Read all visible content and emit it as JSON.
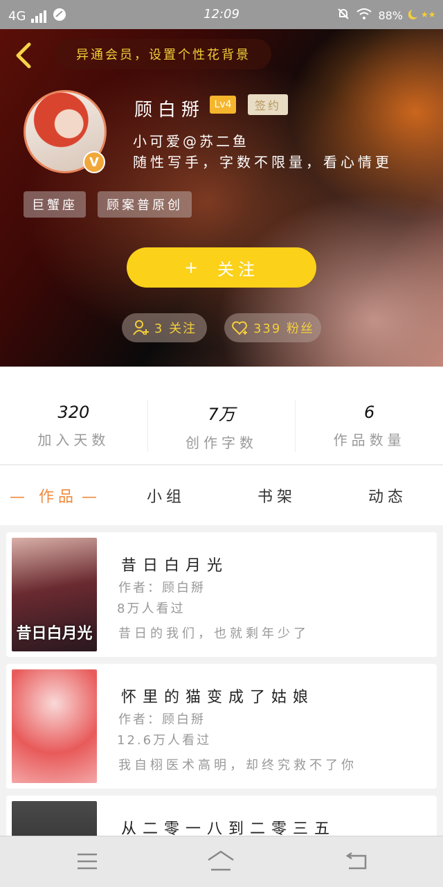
{
  "status_bar": {
    "network": "4G",
    "time": "12:09",
    "battery": "88%"
  },
  "header": {
    "banner_text": "异通会员，设置个性花背景",
    "name": "顾白掰",
    "level": "Lv4",
    "signed_badge": "签约",
    "sub_name": "小可爱@苏二鱼",
    "bio": "随性写手，字数不限量，看心情更",
    "tags": [
      "巨蟹座",
      "顾案普原创"
    ],
    "follow_label": "关注",
    "follow_count": "3 关注",
    "fans_count": "339 粉丝",
    "accent_color": "#fbd11a"
  },
  "stats": [
    {
      "value": "320",
      "label": "加入天数"
    },
    {
      "value": "7万",
      "label": "创作字数"
    },
    {
      "value": "6",
      "label": "作品数量"
    }
  ],
  "tabs": [
    "作品",
    "小组",
    "书架",
    "动态"
  ],
  "works": [
    {
      "title": "昔日白月光",
      "cover_text": "昔日白月光",
      "author": "作者：顾白掰",
      "reads": "8万人看过",
      "desc": "昔日的我们，也就剩年少了"
    },
    {
      "title": "怀里的猫变成了姑娘",
      "cover_text": "",
      "author": "作者：顾白掰",
      "reads": "12.6万人看过",
      "desc": "我自栩医术高明，却终究救不了你"
    },
    {
      "title": "从二零一八到二零三五",
      "cover_text": "",
      "author": "",
      "reads": "",
      "desc": ""
    }
  ]
}
